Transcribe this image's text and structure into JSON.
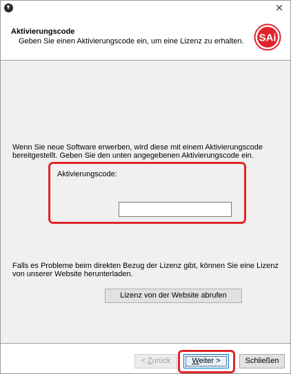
{
  "window": {
    "close_symbol": "×"
  },
  "header": {
    "title": "Aktivierungscode",
    "subtitle": "Geben Sie einen Aktivierungscode ein, um eine Lizenz zu erhalten.",
    "logo_text": "SAi",
    "logo_color": "#e0242b"
  },
  "main": {
    "intro_text": "Wenn Sie neue Software erwerben, wird diese mit einem Aktivierungscode bereitgestellt.  Geben Sie den unten angegebenen Aktivierungscode ein.",
    "code_label": "Aktivierungscode:",
    "code_value": "",
    "problem_text": "Falls es Probleme beim direkten Bezug der Lizenz gibt, können Sie eine Lizenz von unserer Website herunterladen.",
    "website_button": "Lizenz von der Website abrufen"
  },
  "footer": {
    "back_prefix": "< ",
    "back_accel": "Z",
    "back_rest": "urück",
    "next_accel": "W",
    "next_rest": "eiter >",
    "close_label": "Schließen"
  },
  "highlight_color": "#e0242b"
}
